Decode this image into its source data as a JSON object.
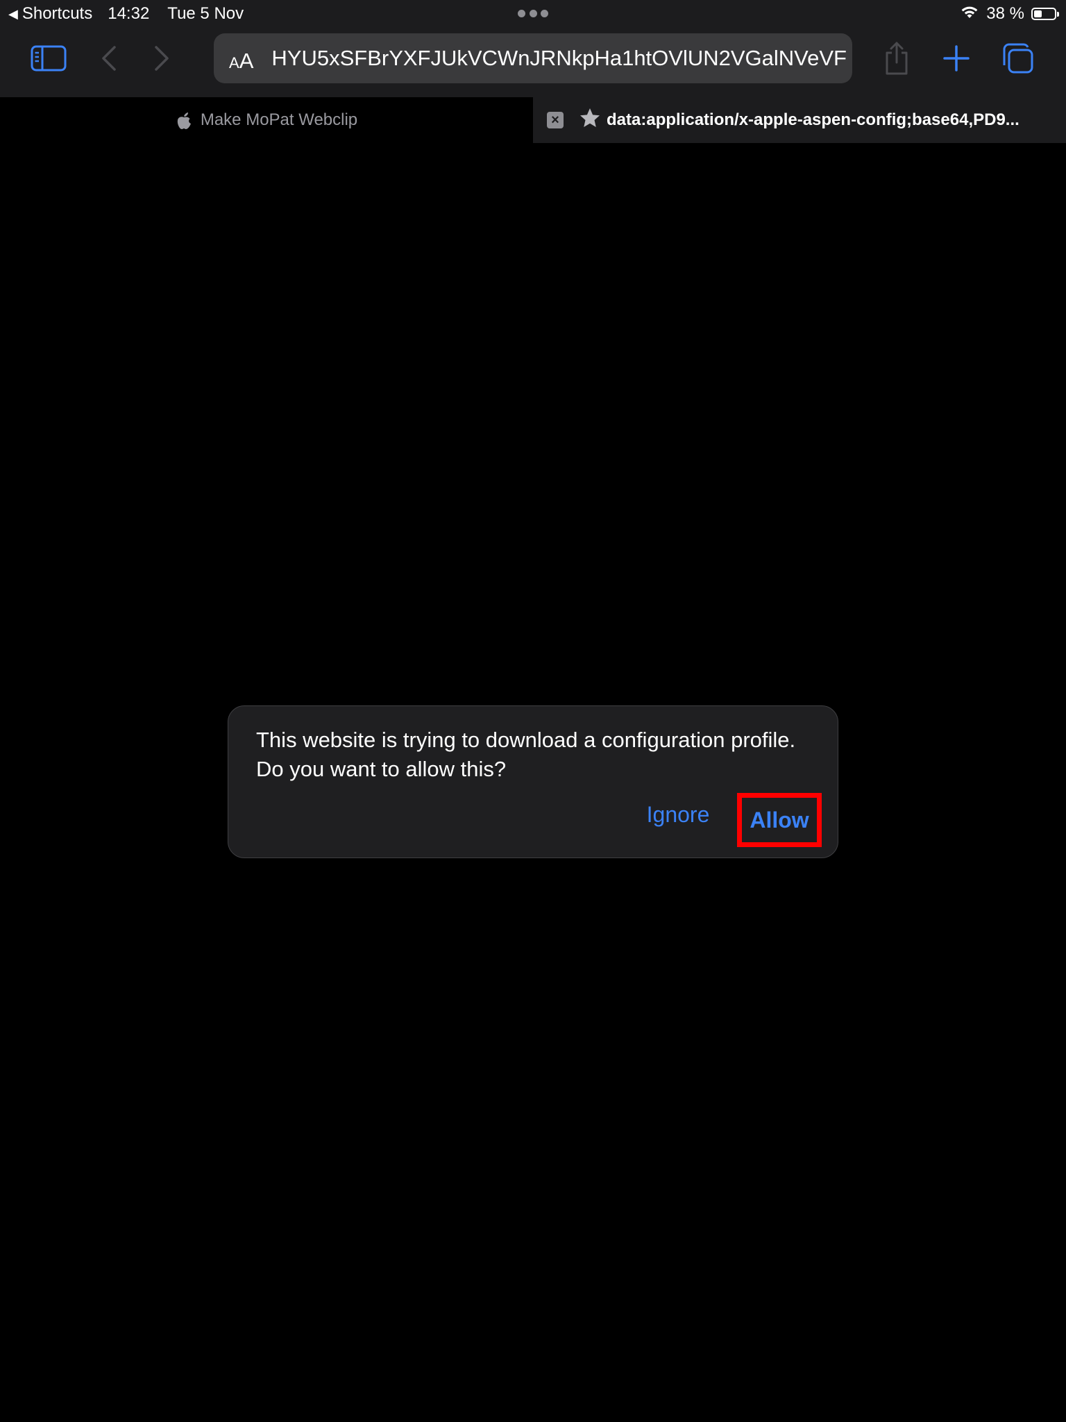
{
  "status_bar": {
    "back_app": "Shortcuts",
    "time": "14:32",
    "date": "Tue 5 Nov",
    "battery_percent": "38 %",
    "battery_level": 0.38
  },
  "toolbar": {
    "reader_small": "A",
    "reader_big": "A",
    "url": "HYU5xSFBrYXFJUkVCWnJRNkpHa1htOVlUN2VGalNVeVF"
  },
  "tabs": [
    {
      "label": "Make MoPat Webclip"
    },
    {
      "label": "data:application/x-apple-aspen-config;base64,PD9..."
    }
  ],
  "dialog": {
    "message": "This website is trying to download a configuration profile. Do you want to allow this?",
    "ignore_label": "Ignore",
    "allow_label": "Allow"
  },
  "colors": {
    "accent": "#3b82f6",
    "highlight": "#ff0000",
    "bar_background": "#1c1c1e"
  }
}
